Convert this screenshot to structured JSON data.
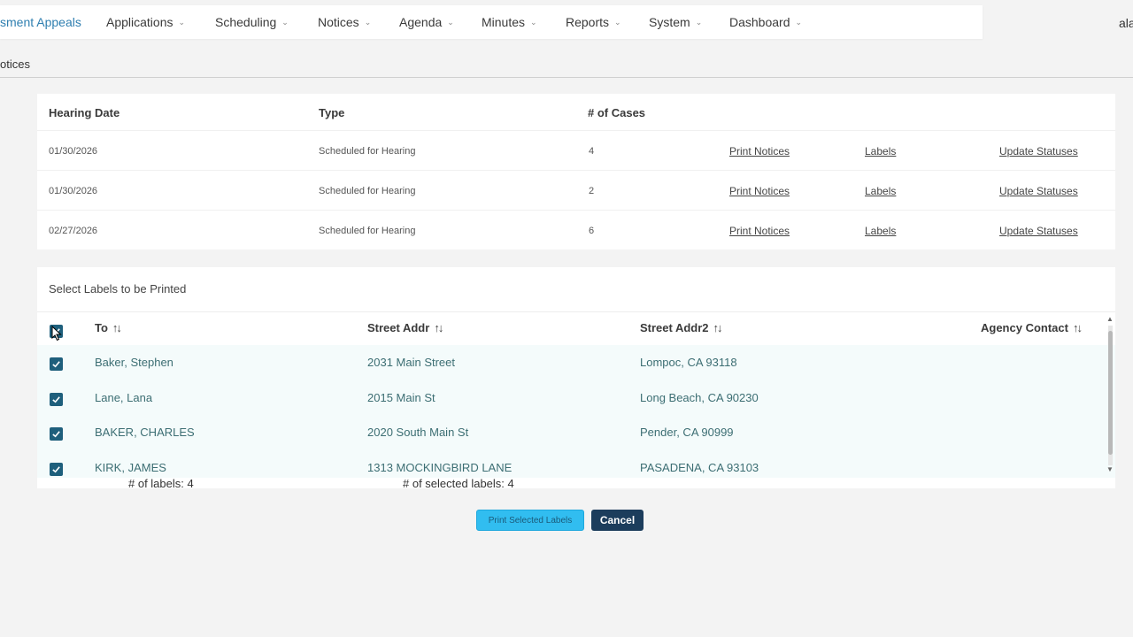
{
  "nav": {
    "items": [
      {
        "label": "sment Appeals"
      },
      {
        "label": "Applications"
      },
      {
        "label": "Scheduling"
      },
      {
        "label": "Notices"
      },
      {
        "label": "Agenda"
      },
      {
        "label": "Minutes"
      },
      {
        "label": "Reports"
      },
      {
        "label": "System"
      },
      {
        "label": "Dashboard"
      }
    ],
    "user_fragment": "ala",
    "active_color": "#2f7fb0"
  },
  "breadcrumb": "otices",
  "hearings": {
    "headers": {
      "date": "Hearing Date",
      "type": "Type",
      "cases": "# of Cases"
    },
    "rows": [
      {
        "date": "01/30/2026",
        "type": "Scheduled for Hearing",
        "cases": "4",
        "print": "Print Notices",
        "labels": "Labels",
        "update": "Update Statuses"
      },
      {
        "date": "01/30/2026",
        "type": "Scheduled for Hearing",
        "cases": "2",
        "print": "Print Notices",
        "labels": "Labels",
        "update": "Update Statuses"
      },
      {
        "date": "02/27/2026",
        "type": "Scheduled for Hearing",
        "cases": "6",
        "print": "Print Notices",
        "labels": "Labels",
        "update": "Update Statuses"
      }
    ]
  },
  "labels": {
    "title": "Select Labels to be Printed",
    "headers": {
      "to": "To",
      "street": "Street Addr",
      "street2": "Street Addr2",
      "agency": "Agency Contact"
    },
    "sort_icon": "sort-arrows-icon",
    "rows": [
      {
        "to": "Baker, Stephen",
        "street": "2031 Main Street",
        "street2": "Lompoc, CA 93118",
        "checked": true
      },
      {
        "to": "Lane, Lana",
        "street": "2015 Main St",
        "street2": "Long Beach, CA 90230",
        "checked": true
      },
      {
        "to": "BAKER, CHARLES",
        "street": "2020 South Main St",
        "street2": "Pender, CA 90999",
        "checked": true
      },
      {
        "to": "KIRK, JAMES",
        "street": "1313 MOCKINGBIRD LANE",
        "street2": "PASADENA, CA 93103",
        "checked": true
      }
    ],
    "count_label": "# of labels: 4",
    "selected_label": "# of selected labels: 4"
  },
  "buttons": {
    "print_label": "Print Selected Labels",
    "cancel_label": "Cancel",
    "print_color": "#31bdf0",
    "cancel_color": "#1c3d5c"
  }
}
